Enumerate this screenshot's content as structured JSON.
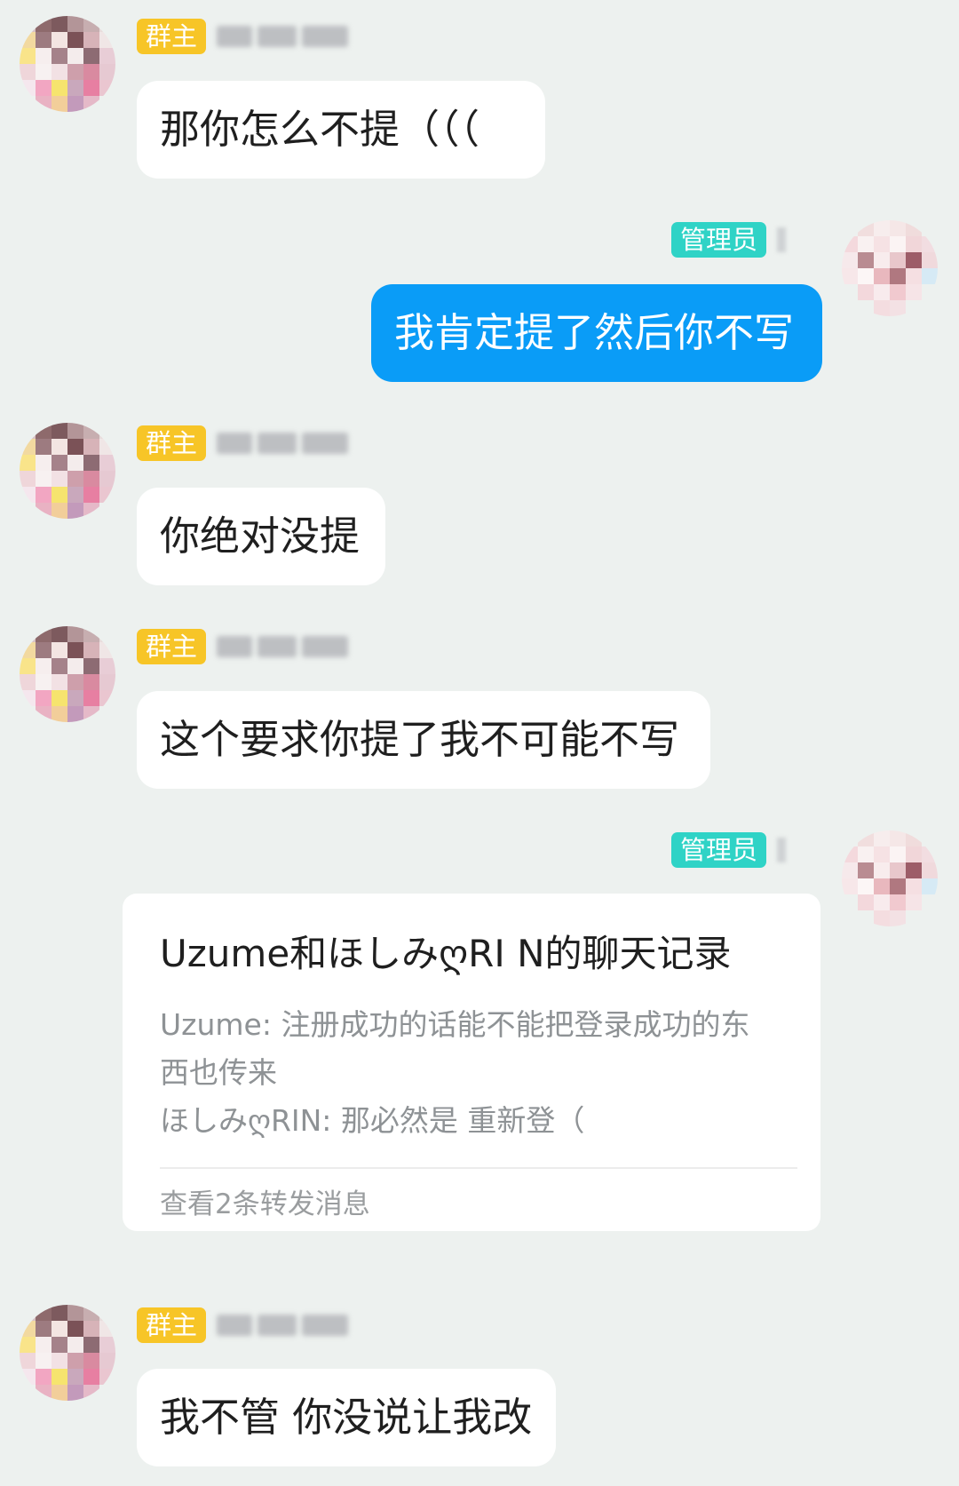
{
  "badges": {
    "owner": "群主",
    "admin": "管理员"
  },
  "colors": {
    "background": "#edf1ef",
    "owner_badge": "#f7c527",
    "admin_badge": "#2fd3c6",
    "outgoing_bubble": "#0a9cf7",
    "incoming_bubble": "#ffffff"
  },
  "messages": [
    {
      "side": "left",
      "role": "群主",
      "text": "那你怎么不提（（（"
    },
    {
      "side": "right",
      "role": "管理员",
      "text": "我肯定提了然后你不写"
    },
    {
      "side": "left",
      "role": "群主",
      "text": "你绝对没提"
    },
    {
      "side": "left",
      "role": "群主",
      "text": "这个要求你提了我不可能不写"
    },
    {
      "side": "right",
      "role": "管理员",
      "type": "forward-card"
    },
    {
      "side": "left",
      "role": "群主",
      "text": "我不管 你没说让我改"
    }
  ],
  "forward_card": {
    "title": "Uzume和ほしみღRI N的聊天记录",
    "lines": [
      "Uzume: 注册成功的话能不能把登录成功的东",
      "西也传来",
      "ほしみღRIN: 那必然是 重新登（"
    ],
    "footer": "查看2条转发消息"
  }
}
